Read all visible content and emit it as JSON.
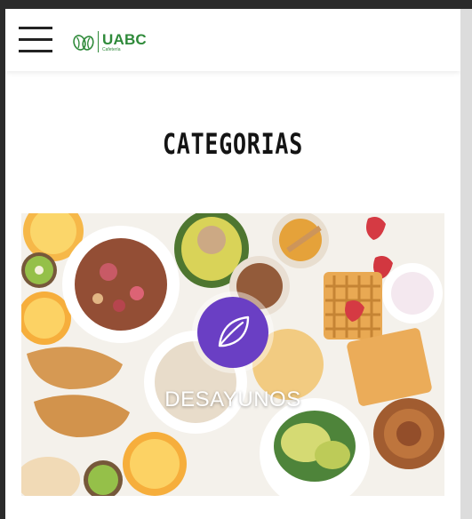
{
  "header": {
    "logo_title": "UABC",
    "logo_subtitle": "Cafetería",
    "menu_icon": "hamburger-menu-icon",
    "logo_icon": "coffee-beans-icon"
  },
  "main": {
    "title": "CATEGORIAS",
    "categories": [
      {
        "label": "DESAYUNOS",
        "icon": "leaf-icon",
        "icon_color": "#6a3fc4"
      }
    ]
  },
  "colors": {
    "brand_green": "#2f8a3a",
    "accent_purple": "#6a3fc4"
  }
}
